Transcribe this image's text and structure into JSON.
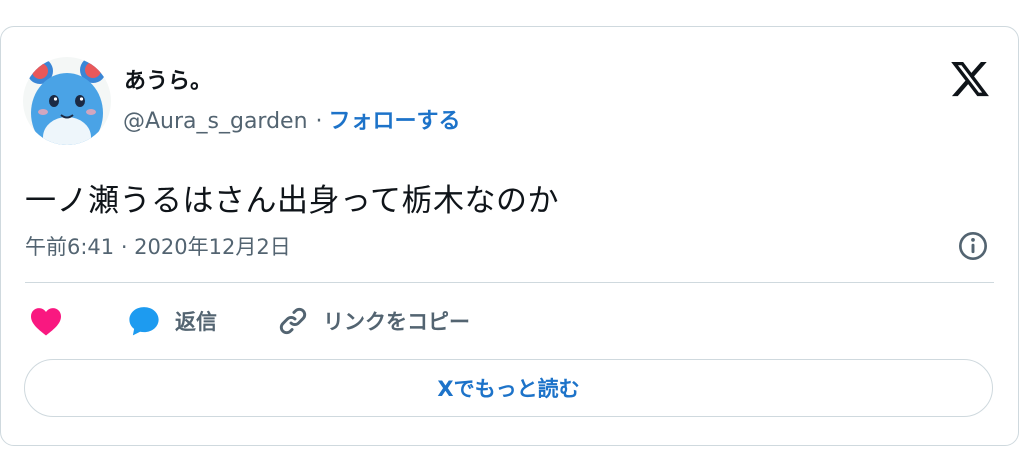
{
  "tweet": {
    "display_name": "あうら。",
    "handle": "@Aura_s_garden",
    "separator": "·",
    "follow_label": "フォローする",
    "text": "一ノ瀬うるはさん出身って栃木なのか",
    "timestamp": "午前6:41 · 2020年12月2日"
  },
  "actions": {
    "like_icon": "heart-icon",
    "reply_label": "返信",
    "copy_link_label": "リンクをコピー"
  },
  "read_more_label": "Xでもっと読む",
  "colors": {
    "like": "#f91880",
    "reply": "#1d9bf0",
    "link": "#1d73c9",
    "muted": "#536471",
    "border": "#cfd9de"
  }
}
